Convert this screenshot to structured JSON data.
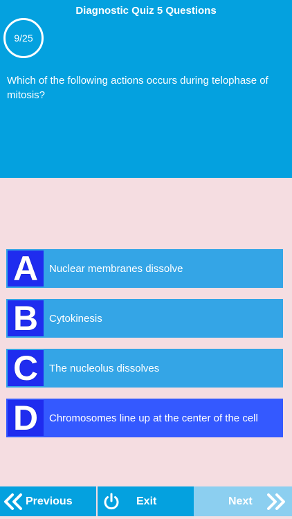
{
  "header": {
    "title": "Diagnostic Quiz 5 Questions",
    "progress": "9/25",
    "question": "Which of the following actions occurs during telophase of mitosis?"
  },
  "answers": [
    {
      "letter": "A",
      "text": "Nuclear membranes dissolve",
      "selected": false
    },
    {
      "letter": "B",
      "text": "Cytokinesis",
      "selected": false
    },
    {
      "letter": "C",
      "text": "The nucleolus dissolves",
      "selected": false
    },
    {
      "letter": "D",
      "text": "Chromosomes line up at the center of the cell",
      "selected": true
    }
  ],
  "footer": {
    "previous_label": "Previous",
    "exit_label": "Exit",
    "next_label": "Next",
    "previous_icon": "double-chevron-left-icon",
    "exit_icon": "power-icon",
    "next_icon": "double-chevron-right-icon"
  },
  "colors": {
    "header_bg": "#04a1df",
    "body_bg": "#f5dde1",
    "answer_bg": "#34a5e6",
    "answer_selected_bg": "#3459ff",
    "letter_bg": "#1f2cef",
    "next_disabled_bg": "#8ccff0"
  }
}
